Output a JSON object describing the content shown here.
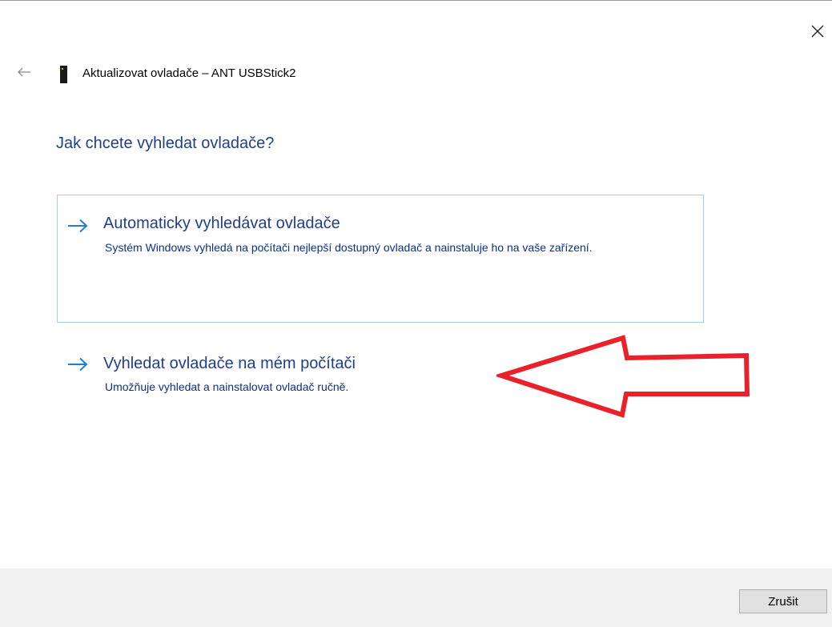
{
  "window": {
    "title": "Aktualizovat ovladače – ANT USBStick2",
    "close_icon": "close-icon",
    "back_icon": "back-arrow-icon",
    "device_icon": "usb-device-icon"
  },
  "page": {
    "heading": "Jak chcete vyhledat ovladače?"
  },
  "options": [
    {
      "icon": "arrow-right-icon",
      "title": "Automaticky vyhledávat ovladače",
      "description": "Systém Windows vyhledá na počítači nejlepší dostupný ovladač a nainstaluje ho na vaše zařízení.",
      "selected": true
    },
    {
      "icon": "arrow-right-icon",
      "title": "Vyhledat ovladače na mém počítači",
      "description": "Umožňuje vyhledat a nainstalovat ovladač ručně.",
      "selected": false
    }
  ],
  "annotation": {
    "shape": "arrow-left",
    "color": "#e8212a",
    "points_to": "options.1"
  },
  "footer": {
    "cancel_label": "Zrušit"
  },
  "colors": {
    "heading": "#1f3f8a",
    "link_text": "#0e2f84",
    "arrow": "#1e7fd1",
    "selection_border": "#a6cfe6",
    "footer_bg": "#f0f0f0"
  }
}
